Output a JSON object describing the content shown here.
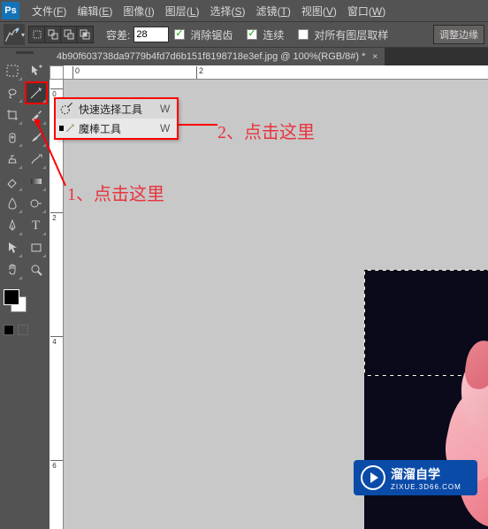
{
  "app": {
    "logo": "Ps"
  },
  "menu": [
    {
      "label": "文件",
      "key": "F"
    },
    {
      "label": "编辑",
      "key": "E"
    },
    {
      "label": "图像",
      "key": "I"
    },
    {
      "label": "图层",
      "key": "L"
    },
    {
      "label": "选择",
      "key": "S"
    },
    {
      "label": "滤镜",
      "key": "T"
    },
    {
      "label": "视图",
      "key": "V"
    },
    {
      "label": "窗口",
      "key": "W"
    }
  ],
  "options": {
    "tolerance_label": "容差:",
    "tolerance_value": "28",
    "antialias": "消除锯齿",
    "contiguous": "连续",
    "all_layers": "对所有图层取样",
    "refine_edge": "调整边缘"
  },
  "doc_tab": {
    "title": "4b90f603738da9779b4fd7d6b151f8198718e3ef.jpg @ 100%(RGB/8#) *",
    "close": "×"
  },
  "flyout": {
    "items": [
      {
        "label": "快速选择工具",
        "key": "W"
      },
      {
        "label": "魔棒工具",
        "key": "W"
      }
    ]
  },
  "annotations": {
    "a1": "1、点击这里",
    "a2": "2、点击这里"
  },
  "ruler_h": [
    "0",
    "2"
  ],
  "ruler_v": [
    "0",
    "2",
    "4",
    "6"
  ],
  "watermark": {
    "title": "溜溜自学",
    "sub": "ZIXUE.3D66.COM"
  }
}
